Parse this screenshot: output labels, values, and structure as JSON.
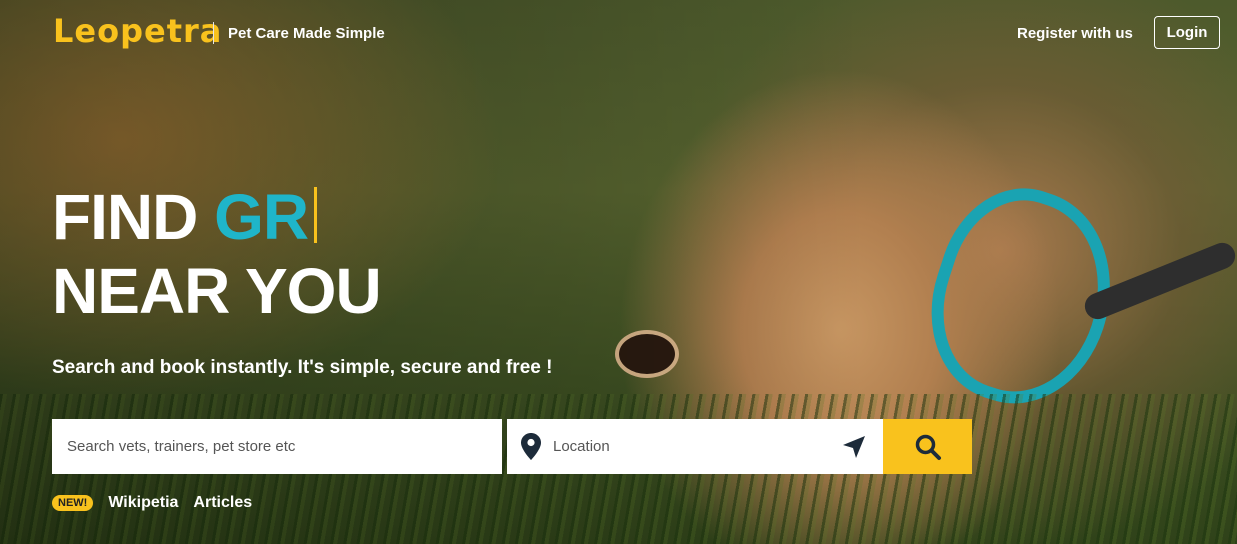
{
  "header": {
    "logo": "Leopetra",
    "tagline": "Pet Care Made Simple",
    "register_label": "Register with us",
    "login_label": "Login"
  },
  "hero": {
    "headline_prefix": "FIND",
    "headline_typed": "GR",
    "headline_line2": "NEAR YOU",
    "subtitle": "Search and book instantly. It's simple, secure and free !"
  },
  "search": {
    "query_placeholder": "Search vets, trainers, pet store etc",
    "location_placeholder": "Location",
    "location_icon": "map-pin-icon",
    "locate_icon": "navigation-arrow-icon",
    "search_icon": "magnifier-icon"
  },
  "links": {
    "badge": "NEW!",
    "items": [
      "Wikipetia",
      "Articles"
    ]
  },
  "colors": {
    "brand_yellow": "#f9c21d",
    "accent_teal": "#1fb5c9"
  }
}
